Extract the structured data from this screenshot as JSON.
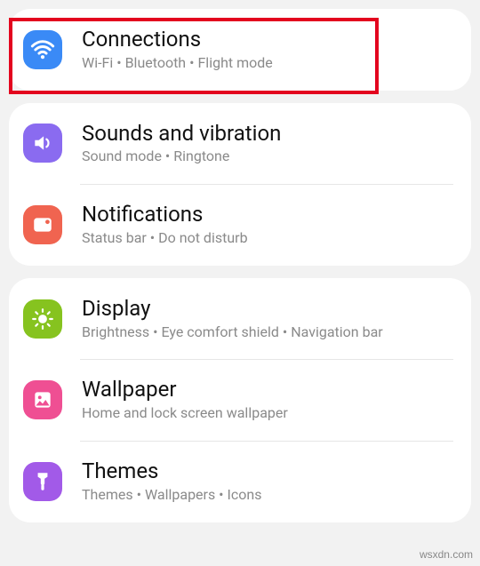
{
  "groups": [
    {
      "items": [
        {
          "key": "connections",
          "title": "Connections",
          "subtitle": "Wi-Fi  •  Bluetooth  •  Flight mode",
          "icon": "wifi-icon",
          "iconBg": "#3a8af6"
        }
      ]
    },
    {
      "items": [
        {
          "key": "sounds",
          "title": "Sounds and vibration",
          "subtitle": "Sound mode  •  Ringtone",
          "icon": "sound-icon",
          "iconBg": "#8a6bf0"
        },
        {
          "key": "notifications",
          "title": "Notifications",
          "subtitle": "Status bar  •  Do not disturb",
          "icon": "notifications-icon",
          "iconBg": "#f06450"
        }
      ]
    },
    {
      "items": [
        {
          "key": "display",
          "title": "Display",
          "subtitle": "Brightness  •  Eye comfort shield  •  Navigation bar",
          "icon": "display-icon",
          "iconBg": "#86c31f"
        },
        {
          "key": "wallpaper",
          "title": "Wallpaper",
          "subtitle": "Home and lock screen wallpaper",
          "icon": "wallpaper-icon",
          "iconBg": "#ef4f93"
        },
        {
          "key": "themes",
          "title": "Themes",
          "subtitle": "Themes  •  Wallpapers  •  Icons",
          "icon": "themes-icon",
          "iconBg": "#a25ae8"
        }
      ]
    }
  ],
  "watermark": "wsxdn.com"
}
